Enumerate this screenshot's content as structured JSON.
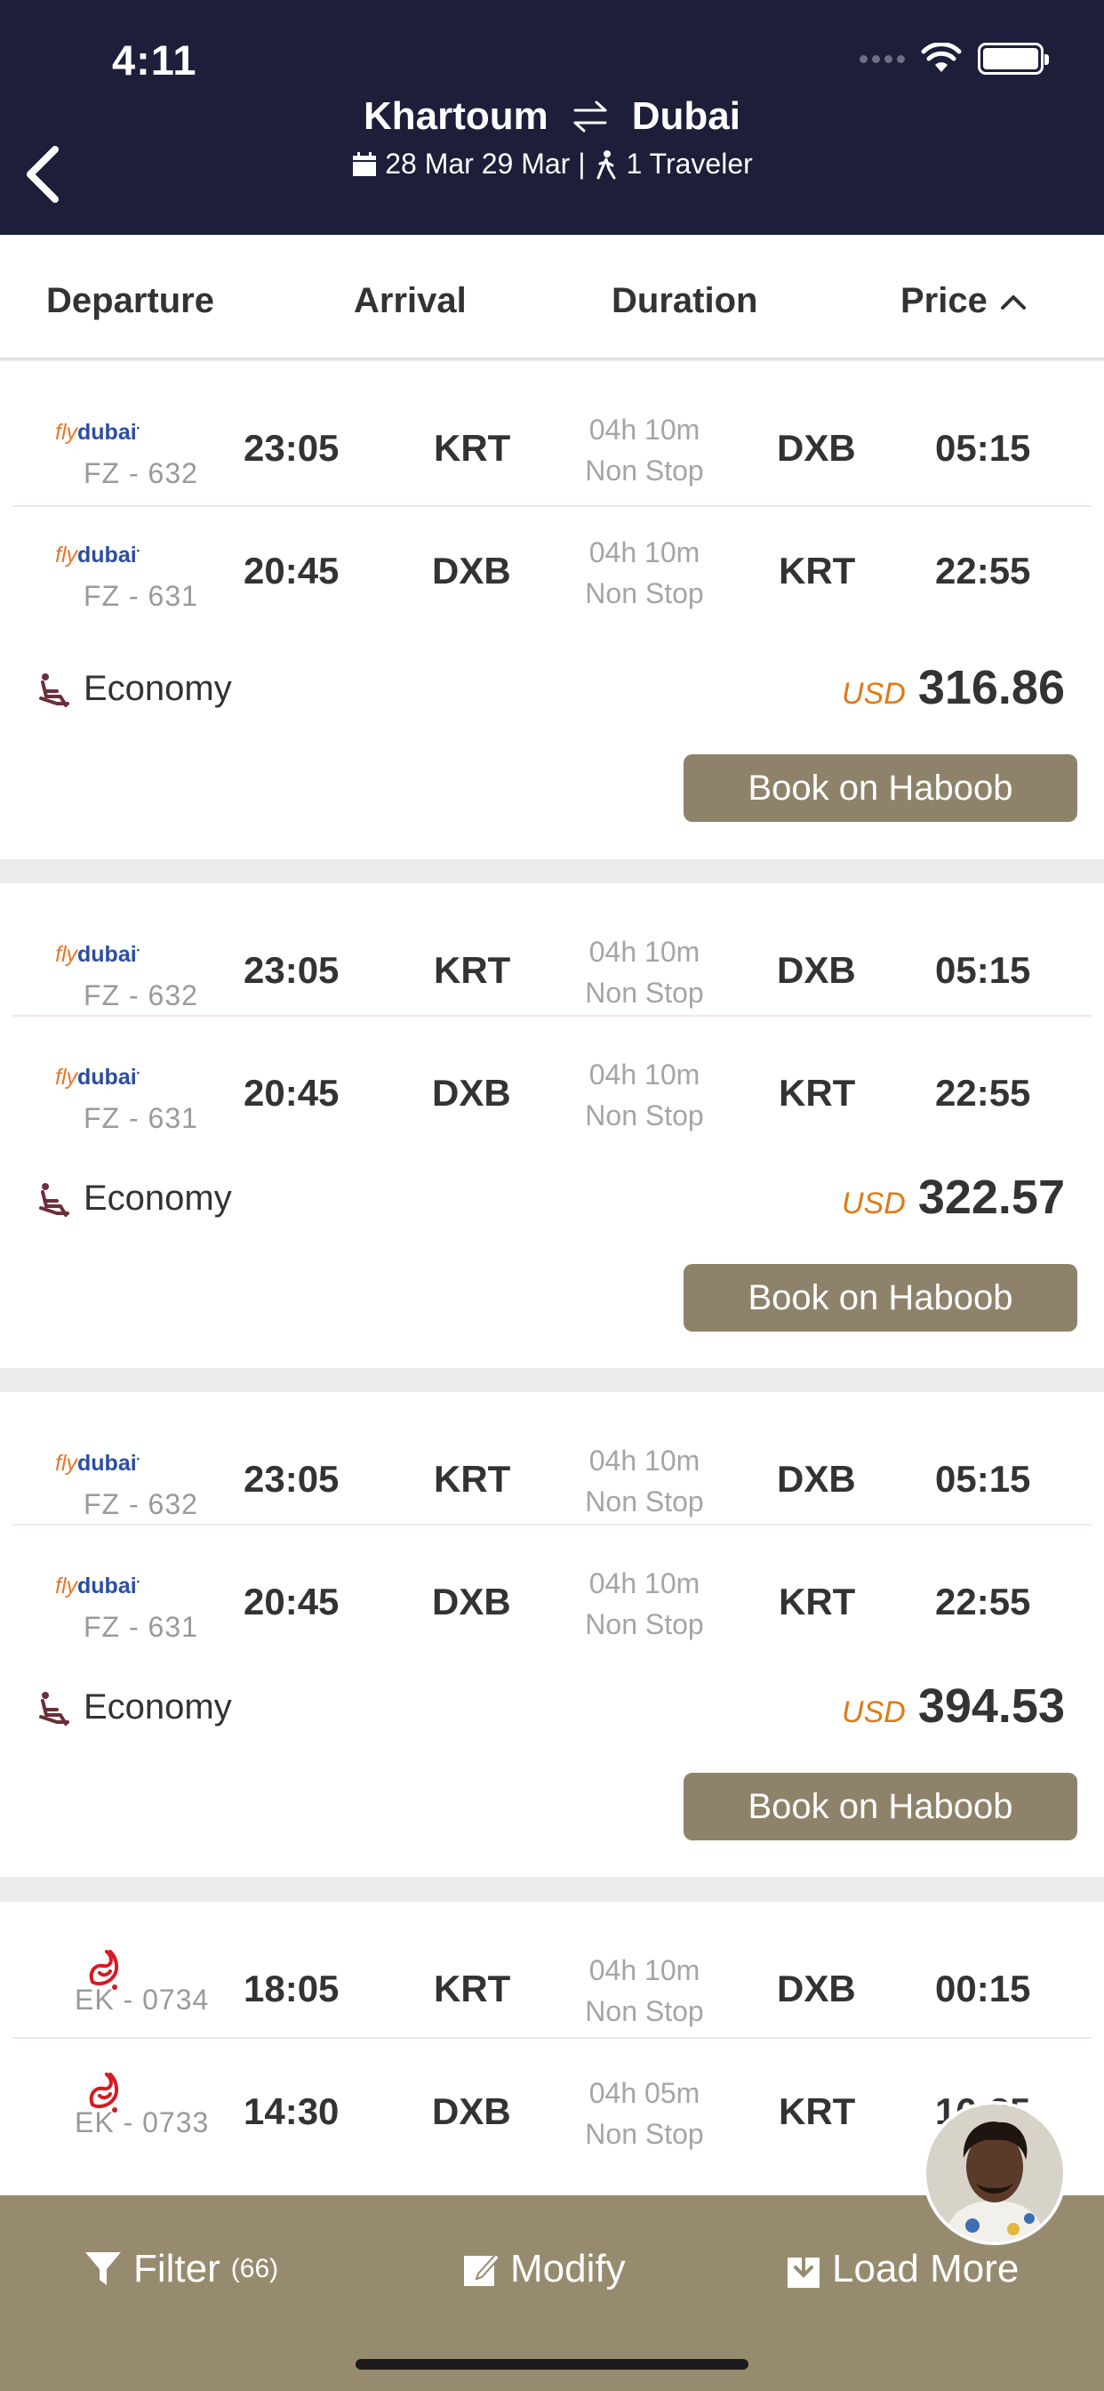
{
  "status_bar": {
    "time": "4:11"
  },
  "header": {
    "origin": "Khartoum",
    "destination": "Dubai",
    "dates": "28 Mar 29 Mar |",
    "travelers": "1 Traveler"
  },
  "sort": {
    "departure": "Departure",
    "arrival": "Arrival",
    "duration": "Duration",
    "price": "Price"
  },
  "cards": [
    {
      "legs": [
        {
          "airline_logo": "flydubai",
          "flight_no": "FZ - 632",
          "dep_time": "23:05",
          "from": "KRT",
          "duration": "04h 10m",
          "stops": "Non Stop",
          "to": "DXB",
          "arr_time": "05:15"
        },
        {
          "airline_logo": "flydubai",
          "flight_no": "FZ - 631",
          "dep_time": "20:45",
          "from": "DXB",
          "duration": "04h 10m",
          "stops": "Non Stop",
          "to": "KRT",
          "arr_time": "22:55"
        }
      ],
      "cabin": "Economy",
      "currency": "USD",
      "amount": "316.86",
      "book_label": "Book on Haboob"
    },
    {
      "legs": [
        {
          "airline_logo": "flydubai",
          "flight_no": "FZ - 632",
          "dep_time": "23:05",
          "from": "KRT",
          "duration": "04h 10m",
          "stops": "Non Stop",
          "to": "DXB",
          "arr_time": "05:15"
        },
        {
          "airline_logo": "flydubai",
          "flight_no": "FZ - 631",
          "dep_time": "20:45",
          "from": "DXB",
          "duration": "04h 10m",
          "stops": "Non Stop",
          "to": "KRT",
          "arr_time": "22:55"
        }
      ],
      "cabin": "Economy",
      "currency": "USD",
      "amount": "322.57",
      "book_label": "Book on Haboob"
    },
    {
      "legs": [
        {
          "airline_logo": "flydubai",
          "flight_no": "FZ - 632",
          "dep_time": "23:05",
          "from": "KRT",
          "duration": "04h 10m",
          "stops": "Non Stop",
          "to": "DXB",
          "arr_time": "05:15"
        },
        {
          "airline_logo": "flydubai",
          "flight_no": "FZ - 631",
          "dep_time": "20:45",
          "from": "DXB",
          "duration": "04h 10m",
          "stops": "Non Stop",
          "to": "KRT",
          "arr_time": "22:55"
        }
      ],
      "cabin": "Economy",
      "currency": "USD",
      "amount": "394.53",
      "book_label": "Book on Haboob"
    },
    {
      "legs": [
        {
          "airline_logo": "emirates",
          "flight_no": "EK - 0734",
          "dep_time": "18:05",
          "from": "KRT",
          "duration": "04h 10m",
          "stops": "Non Stop",
          "to": "DXB",
          "arr_time": "00:15"
        },
        {
          "airline_logo": "emirates",
          "flight_no": "EK - 0733",
          "dep_time": "14:30",
          "from": "DXB",
          "duration": "04h 05m",
          "stops": "Non Stop",
          "to": "KRT",
          "arr_time": "16:35"
        }
      ]
    }
  ],
  "bottom_bar": {
    "filter_label": "Filter",
    "filter_count": "(66)",
    "modify_label": "Modify",
    "load_more_label": "Load More"
  },
  "colors": {
    "header_bg": "#1c1e3a",
    "button_bg": "#8e826a",
    "bottom_bar_bg": "#978b6f",
    "currency": "#e07a15"
  }
}
